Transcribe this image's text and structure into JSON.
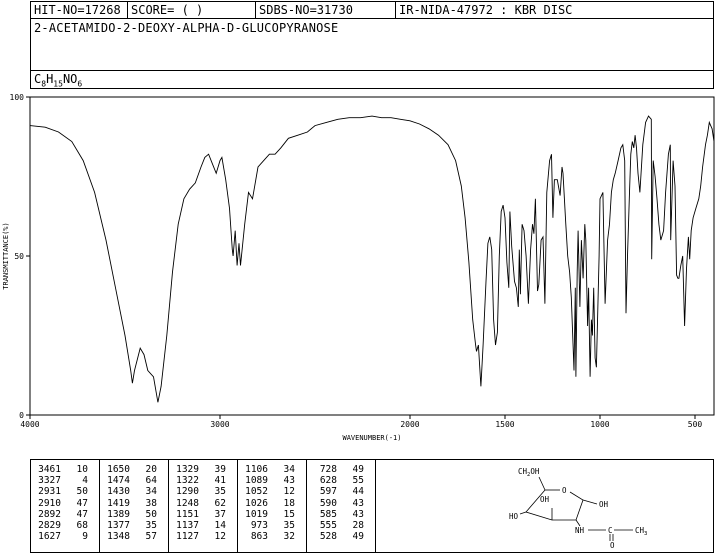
{
  "header": {
    "hit_no": "HIT-NO=17268",
    "score": "SCORE=  (   )",
    "sdbs_no": "SDBS-NO=31730",
    "ir_nida": "IR-NIDA-47972 : KBR DISC",
    "compound_name": "2-ACETAMIDO-2-DEOXY-ALPHA-D-GLUCOPYRANOSE",
    "formula": {
      "c": "C",
      "c_n": "8",
      "h": "H",
      "h_n": "15",
      "no": "NO",
      "o_n": "6"
    }
  },
  "chart_data": {
    "type": "line",
    "xlabel": "WAVENUMBER(-1)",
    "ylabel": "TRANSMITTANCE(%)",
    "xlim": [
      4000,
      400
    ],
    "ylim": [
      0,
      100
    ],
    "x_ticks": [
      {
        "value": 4000,
        "label": "4000"
      },
      {
        "value": 3000,
        "label": "3000"
      },
      {
        "value": 2000,
        "label": "2000"
      },
      {
        "value": 1500,
        "label": "1500"
      },
      {
        "value": 1000,
        "label": "1000"
      },
      {
        "value": 500,
        "label": "500"
      }
    ],
    "y_ticks": [
      {
        "value": 0,
        "label": "0"
      },
      {
        "value": 50,
        "label": "50"
      },
      {
        "value": 100,
        "label": "100"
      }
    ],
    "grid": false,
    "series": [
      {
        "points": [
          [
            4000,
            91
          ],
          [
            3920,
            90.5
          ],
          [
            3850,
            89
          ],
          [
            3780,
            86
          ],
          [
            3720,
            80
          ],
          [
            3660,
            70
          ],
          [
            3600,
            55
          ],
          [
            3550,
            40
          ],
          [
            3500,
            25
          ],
          [
            3470,
            14
          ],
          [
            3461,
            10
          ],
          [
            3450,
            14
          ],
          [
            3420,
            21
          ],
          [
            3400,
            19
          ],
          [
            3380,
            14
          ],
          [
            3350,
            12
          ],
          [
            3327,
            4
          ],
          [
            3310,
            9
          ],
          [
            3280,
            25
          ],
          [
            3250,
            45
          ],
          [
            3220,
            60
          ],
          [
            3190,
            68
          ],
          [
            3160,
            71
          ],
          [
            3130,
            73
          ],
          [
            3100,
            78
          ],
          [
            3080,
            81
          ],
          [
            3060,
            82
          ],
          [
            3040,
            79
          ],
          [
            3020,
            76
          ],
          [
            3000,
            80
          ],
          [
            2990,
            81
          ],
          [
            2970,
            74
          ],
          [
            2950,
            65
          ],
          [
            2942,
            58
          ],
          [
            2935,
            52
          ],
          [
            2931,
            50
          ],
          [
            2920,
            58
          ],
          [
            2910,
            47
          ],
          [
            2900,
            54
          ],
          [
            2892,
            47
          ],
          [
            2870,
            60
          ],
          [
            2850,
            70
          ],
          [
            2829,
            68
          ],
          [
            2800,
            78
          ],
          [
            2770,
            80
          ],
          [
            2740,
            82
          ],
          [
            2710,
            82
          ],
          [
            2680,
            84
          ],
          [
            2640,
            87
          ],
          [
            2590,
            88
          ],
          [
            2540,
            89
          ],
          [
            2500,
            91
          ],
          [
            2440,
            92
          ],
          [
            2380,
            93
          ],
          [
            2320,
            93.5
          ],
          [
            2260,
            93.5
          ],
          [
            2200,
            94
          ],
          [
            2150,
            93.5
          ],
          [
            2100,
            93.5
          ],
          [
            2050,
            93
          ],
          [
            2000,
            92.5
          ],
          [
            1950,
            91.5
          ],
          [
            1900,
            90
          ],
          [
            1850,
            88
          ],
          [
            1800,
            85
          ],
          [
            1760,
            80
          ],
          [
            1730,
            72
          ],
          [
            1710,
            62
          ],
          [
            1690,
            48
          ],
          [
            1670,
            30
          ],
          [
            1655,
            22
          ],
          [
            1650,
            20
          ],
          [
            1640,
            22
          ],
          [
            1627,
            9
          ],
          [
            1615,
            22
          ],
          [
            1600,
            42
          ],
          [
            1590,
            54
          ],
          [
            1580,
            56
          ],
          [
            1570,
            52
          ],
          [
            1560,
            30
          ],
          [
            1550,
            22
          ],
          [
            1540,
            26
          ],
          [
            1530,
            50
          ],
          [
            1520,
            64
          ],
          [
            1510,
            66
          ],
          [
            1500,
            62
          ],
          [
            1490,
            48
          ],
          [
            1480,
            40
          ],
          [
            1474,
            64
          ],
          [
            1465,
            53
          ],
          [
            1450,
            42
          ],
          [
            1440,
            40
          ],
          [
            1430,
            34
          ],
          [
            1425,
            52
          ],
          [
            1419,
            38
          ],
          [
            1410,
            60
          ],
          [
            1400,
            58
          ],
          [
            1389,
            50
          ],
          [
            1377,
            35
          ],
          [
            1365,
            52
          ],
          [
            1355,
            60
          ],
          [
            1348,
            57
          ],
          [
            1340,
            68
          ],
          [
            1329,
            39
          ],
          [
            1322,
            41
          ],
          [
            1310,
            55
          ],
          [
            1300,
            56
          ],
          [
            1290,
            35
          ],
          [
            1280,
            70
          ],
          [
            1265,
            80
          ],
          [
            1255,
            82
          ],
          [
            1248,
            62
          ],
          [
            1240,
            74
          ],
          [
            1225,
            74
          ],
          [
            1210,
            69
          ],
          [
            1200,
            78
          ],
          [
            1195,
            76
          ],
          [
            1180,
            60
          ],
          [
            1170,
            50
          ],
          [
            1160,
            45
          ],
          [
            1151,
            37
          ],
          [
            1137,
            14
          ],
          [
            1130,
            40
          ],
          [
            1127,
            12
          ],
          [
            1120,
            45
          ],
          [
            1115,
            58
          ],
          [
            1106,
            34
          ],
          [
            1098,
            55
          ],
          [
            1089,
            43
          ],
          [
            1080,
            60
          ],
          [
            1075,
            55
          ],
          [
            1065,
            28
          ],
          [
            1060,
            40
          ],
          [
            1052,
            12
          ],
          [
            1045,
            30
          ],
          [
            1040,
            25
          ],
          [
            1033,
            40
          ],
          [
            1026,
            18
          ],
          [
            1019,
            15
          ],
          [
            1005,
            50
          ],
          [
            1000,
            68
          ],
          [
            985,
            70
          ],
          [
            973,
            35
          ],
          [
            960,
            55
          ],
          [
            950,
            60
          ],
          [
            940,
            70
          ],
          [
            930,
            74
          ],
          [
            920,
            76
          ],
          [
            905,
            80
          ],
          [
            890,
            84
          ],
          [
            880,
            85
          ],
          [
            870,
            80
          ],
          [
            863,
            32
          ],
          [
            855,
            50
          ],
          [
            845,
            70
          ],
          [
            838,
            82
          ],
          [
            830,
            86
          ],
          [
            822,
            84
          ],
          [
            815,
            88
          ],
          [
            808,
            84
          ],
          [
            800,
            76
          ],
          [
            790,
            70
          ],
          [
            775,
            85
          ],
          [
            760,
            92
          ],
          [
            745,
            94
          ],
          [
            730,
            93
          ],
          [
            728,
            49
          ],
          [
            720,
            80
          ],
          [
            710,
            75
          ],
          [
            700,
            68
          ],
          [
            690,
            60
          ],
          [
            680,
            55
          ],
          [
            670,
            57
          ],
          [
            665,
            58
          ],
          [
            655,
            70
          ],
          [
            640,
            82
          ],
          [
            630,
            85
          ],
          [
            628,
            55
          ],
          [
            615,
            80
          ],
          [
            605,
            72
          ],
          [
            597,
            44
          ],
          [
            590,
            43
          ],
          [
            585,
            43
          ],
          [
            575,
            47
          ],
          [
            565,
            50
          ],
          [
            555,
            28
          ],
          [
            545,
            46
          ],
          [
            535,
            56
          ],
          [
            528,
            49
          ],
          [
            520,
            58
          ],
          [
            510,
            62
          ],
          [
            495,
            65
          ],
          [
            480,
            68
          ],
          [
            470,
            72
          ],
          [
            460,
            78
          ],
          [
            445,
            85
          ],
          [
            435,
            88
          ],
          [
            425,
            92
          ],
          [
            410,
            90
          ],
          [
            400,
            86
          ]
        ]
      }
    ]
  },
  "peak_table": {
    "columns": [
      [
        [
          "3461",
          "10"
        ],
        [
          "3327",
          "4"
        ],
        [
          "2931",
          "50"
        ],
        [
          "2910",
          "47"
        ],
        [
          "2892",
          "47"
        ],
        [
          "2829",
          "68"
        ],
        [
          "1627",
          "9"
        ]
      ],
      [
        [
          "1650",
          "20"
        ],
        [
          "1474",
          "64"
        ],
        [
          "1430",
          "34"
        ],
        [
          "1419",
          "38"
        ],
        [
          "1389",
          "50"
        ],
        [
          "1377",
          "35"
        ],
        [
          "1348",
          "57"
        ]
      ],
      [
        [
          "1329",
          "39"
        ],
        [
          "1322",
          "41"
        ],
        [
          "1290",
          "35"
        ],
        [
          "1248",
          "62"
        ],
        [
          "1151",
          "37"
        ],
        [
          "1137",
          "14"
        ],
        [
          "1127",
          "12"
        ]
      ],
      [
        [
          "1106",
          "34"
        ],
        [
          "1089",
          "43"
        ],
        [
          "1052",
          "12"
        ],
        [
          "1026",
          "18"
        ],
        [
          "1019",
          "15"
        ],
        [
          "973",
          "35"
        ],
        [
          "863",
          "32"
        ]
      ],
      [
        [
          "728",
          "49"
        ],
        [
          "628",
          "55"
        ],
        [
          "597",
          "44"
        ],
        [
          "590",
          "43"
        ],
        [
          "585",
          "43"
        ],
        [
          "555",
          "28"
        ],
        [
          "528",
          "49"
        ]
      ]
    ]
  },
  "structure": {
    "ch2oh": "CH2OH",
    "ch2oh_main": "CH",
    "ch2oh_sub": "2",
    "ch2oh_tail": "OH",
    "ring_o": "O",
    "oh_top": "OH",
    "oh_right": "OH",
    "oh_mid": "OH",
    "ho_left": "HO",
    "nh": "NH",
    "c": "C",
    "ch3": "CH3",
    "ch3_main": "CH",
    "ch3_sub": "3",
    "o": "O"
  }
}
